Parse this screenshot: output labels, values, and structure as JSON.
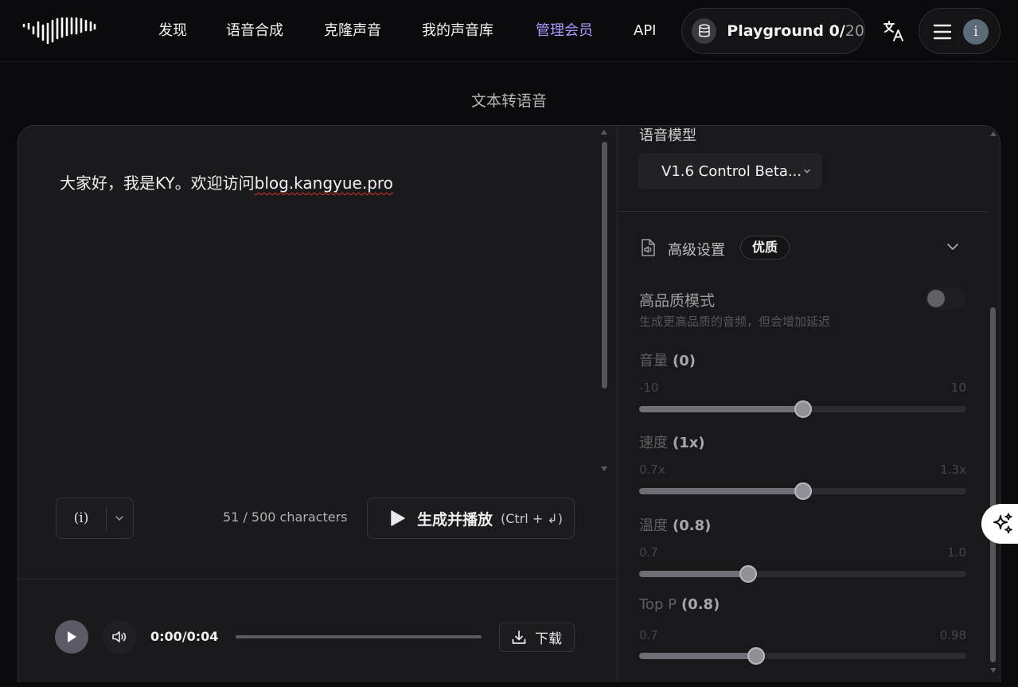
{
  "nav": {
    "items": [
      {
        "label": "发现",
        "active": false
      },
      {
        "label": "语音合成",
        "active": false
      },
      {
        "label": "克隆声音",
        "active": false
      },
      {
        "label": "我的声音库",
        "active": false
      },
      {
        "label": "管理会员",
        "active": true
      },
      {
        "label": "API",
        "active": false
      }
    ],
    "playground": {
      "label": "Playground",
      "used": "0/",
      "total": "20",
      "icon": "database-icon"
    },
    "translate_icon": "translate-icon",
    "menu_icon": "hamburger-icon",
    "avatar_initial": "i",
    "active_color": "#a99bff"
  },
  "page_title": "文本转语音",
  "editor": {
    "text_prefix": "大家好，我是KY。欢迎访问",
    "text_url": "blog.kangyue.pro",
    "info_button": "(i)",
    "char_count": "51 / 500 characters",
    "generate_label": "生成并播放",
    "generate_shortcut": "(Ctrl + ↲)"
  },
  "player": {
    "time": "0:00/0:04",
    "progress": 0,
    "download_label": "下载"
  },
  "settings": {
    "model_label": "语音模型",
    "model_value": "V1.6 Control Beta...",
    "advanced_label": "高级设置",
    "quality_badge": "优质",
    "hq_mode_label": "高品质模式",
    "hq_mode_desc": "生成更高品质的音频，但会增加延迟",
    "hq_mode_on": false,
    "sliders": [
      {
        "name": "volume",
        "label": "音量",
        "value_text": "(0)",
        "min": "-10",
        "max": "10",
        "min_v": -10,
        "max_v": 10,
        "value": 0
      },
      {
        "name": "speed",
        "label": "速度",
        "value_text": "(1x)",
        "min": "0.7x",
        "max": "1.3x",
        "min_v": 0.7,
        "max_v": 1.3,
        "value": 1.0
      },
      {
        "name": "temperature",
        "label": "温度",
        "value_text": "(0.8)",
        "min": "0.7",
        "max": "1.0",
        "min_v": 0.7,
        "max_v": 1.0,
        "value": 0.8
      },
      {
        "name": "top-p",
        "label": "Top P",
        "value_text": "(0.8)",
        "min": "0.7",
        "max": "0.98",
        "min_v": 0.7,
        "max_v": 0.98,
        "value": 0.8
      }
    ]
  }
}
